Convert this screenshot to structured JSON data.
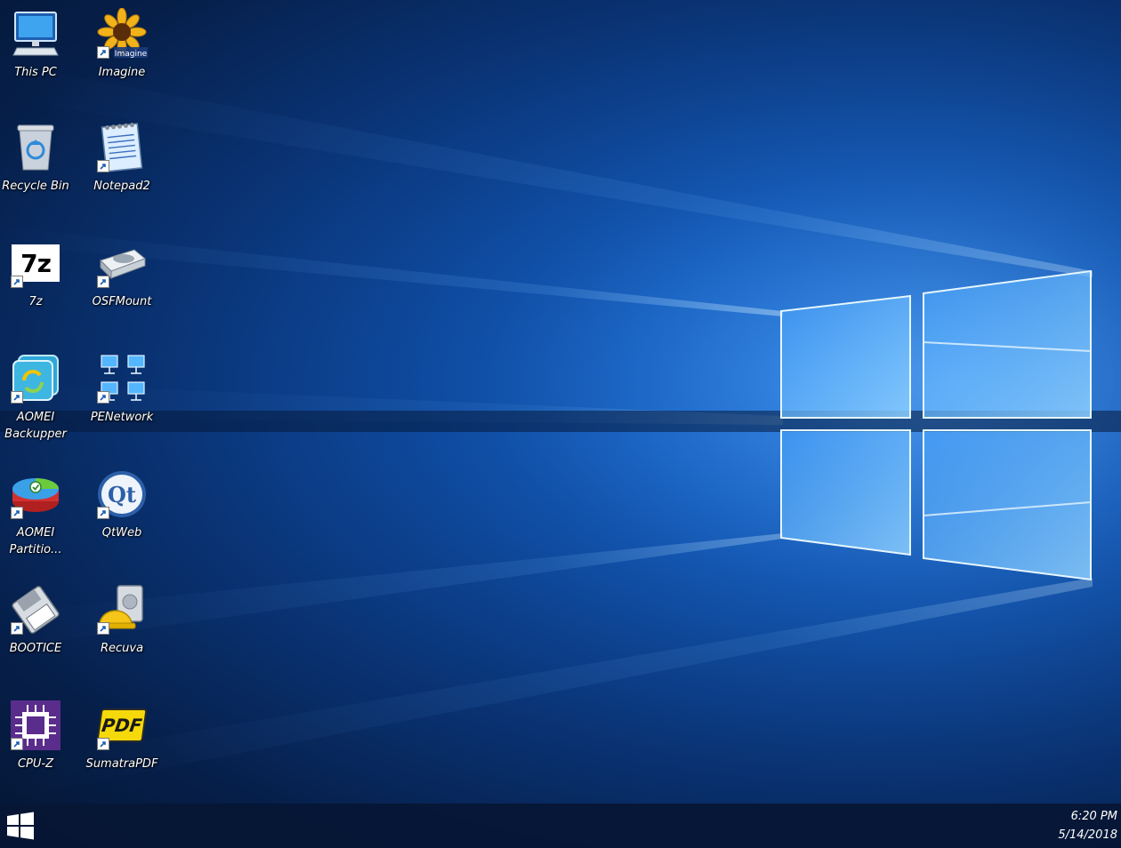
{
  "desktop": {
    "icons": [
      {
        "label": "This PC",
        "icon": "computer-icon"
      },
      {
        "label": "Imagine",
        "icon": "sunflower-icon",
        "badge": "Imagine"
      },
      {
        "label": "Recycle Bin",
        "icon": "recycle-bin-icon"
      },
      {
        "label": "Notepad2",
        "icon": "notepad-icon"
      },
      {
        "label": "7z",
        "icon": "7z-archive-icon",
        "glyph": "7z"
      },
      {
        "label": "OSFMount",
        "icon": "disk-mount-icon"
      },
      {
        "label": "AOMEI Backupper",
        "icon": "backup-icon"
      },
      {
        "label": "PENetwork",
        "icon": "network-icon"
      },
      {
        "label": "AOMEI Partitio...",
        "icon": "partition-icon"
      },
      {
        "label": "QtWeb",
        "icon": "qt-logo-icon",
        "glyph": "Qt"
      },
      {
        "label": "BOOTICE",
        "icon": "floppy-icon"
      },
      {
        "label": "Recuva",
        "icon": "hard-hat-drive-icon"
      },
      {
        "label": "CPU-Z",
        "icon": "cpu-chip-icon"
      },
      {
        "label": "SumatraPDF",
        "icon": "pdf-icon",
        "glyph": "PDF"
      }
    ]
  },
  "taskbar": {
    "start_icon": "windows-logo-icon",
    "clock": {
      "time": "6:20 PM",
      "date": "5/14/2018"
    }
  },
  "colors": {
    "wallpaper_dark": "#041633",
    "wallpaper_glow": "#2a7de0",
    "taskbar": "#061634",
    "label_text": "#ffffff"
  }
}
